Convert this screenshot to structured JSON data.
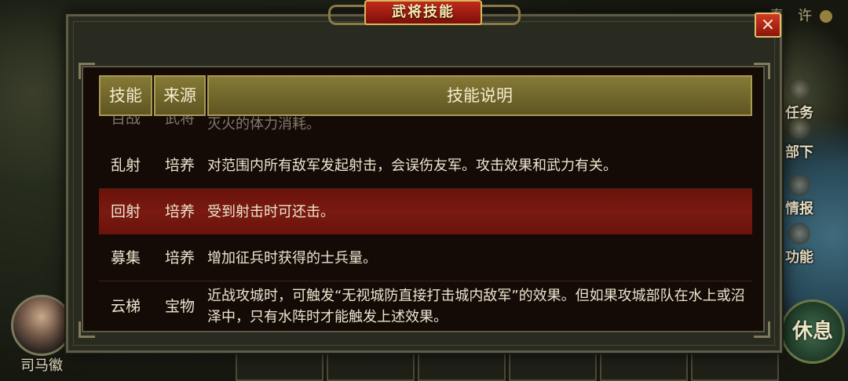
{
  "background": {
    "top_name": "春 许",
    "side_buttons": [
      "任务",
      "部下",
      "情报",
      "功能"
    ],
    "rest_button": "休息",
    "avatar_name": "司马徽"
  },
  "dialog": {
    "title": "武将技能",
    "close_label": "×",
    "table": {
      "headers": [
        "技能",
        "来源",
        "技能说明"
      ],
      "partial_row": {
        "skill": "百战",
        "source": "武将",
        "desc": "灭火的体力消耗。"
      },
      "rows": [
        {
          "skill": "乱射",
          "source": "培养",
          "desc": "对范围内所有敌军发起射击，会误伤友军。攻击效果和武力有关。"
        },
        {
          "skill": "回射",
          "source": "培养",
          "desc": "受到射击时可还击。"
        },
        {
          "skill": "募集",
          "source": "培养",
          "desc": "增加征兵时获得的士兵量。"
        },
        {
          "skill": "云梯",
          "source": "宝物",
          "desc": "近战攻城时，可触发“无视城防直接打击城内敌军”的效果。但如果攻城部队在水上或沼泽中，只有水阵时才能触发上述效果。"
        }
      ]
    }
  },
  "colors": {
    "header_bg": "#7a6f30",
    "selected_row": "#6e150d",
    "title_plate": "#b0241a",
    "close_button": "#b32a1a"
  }
}
